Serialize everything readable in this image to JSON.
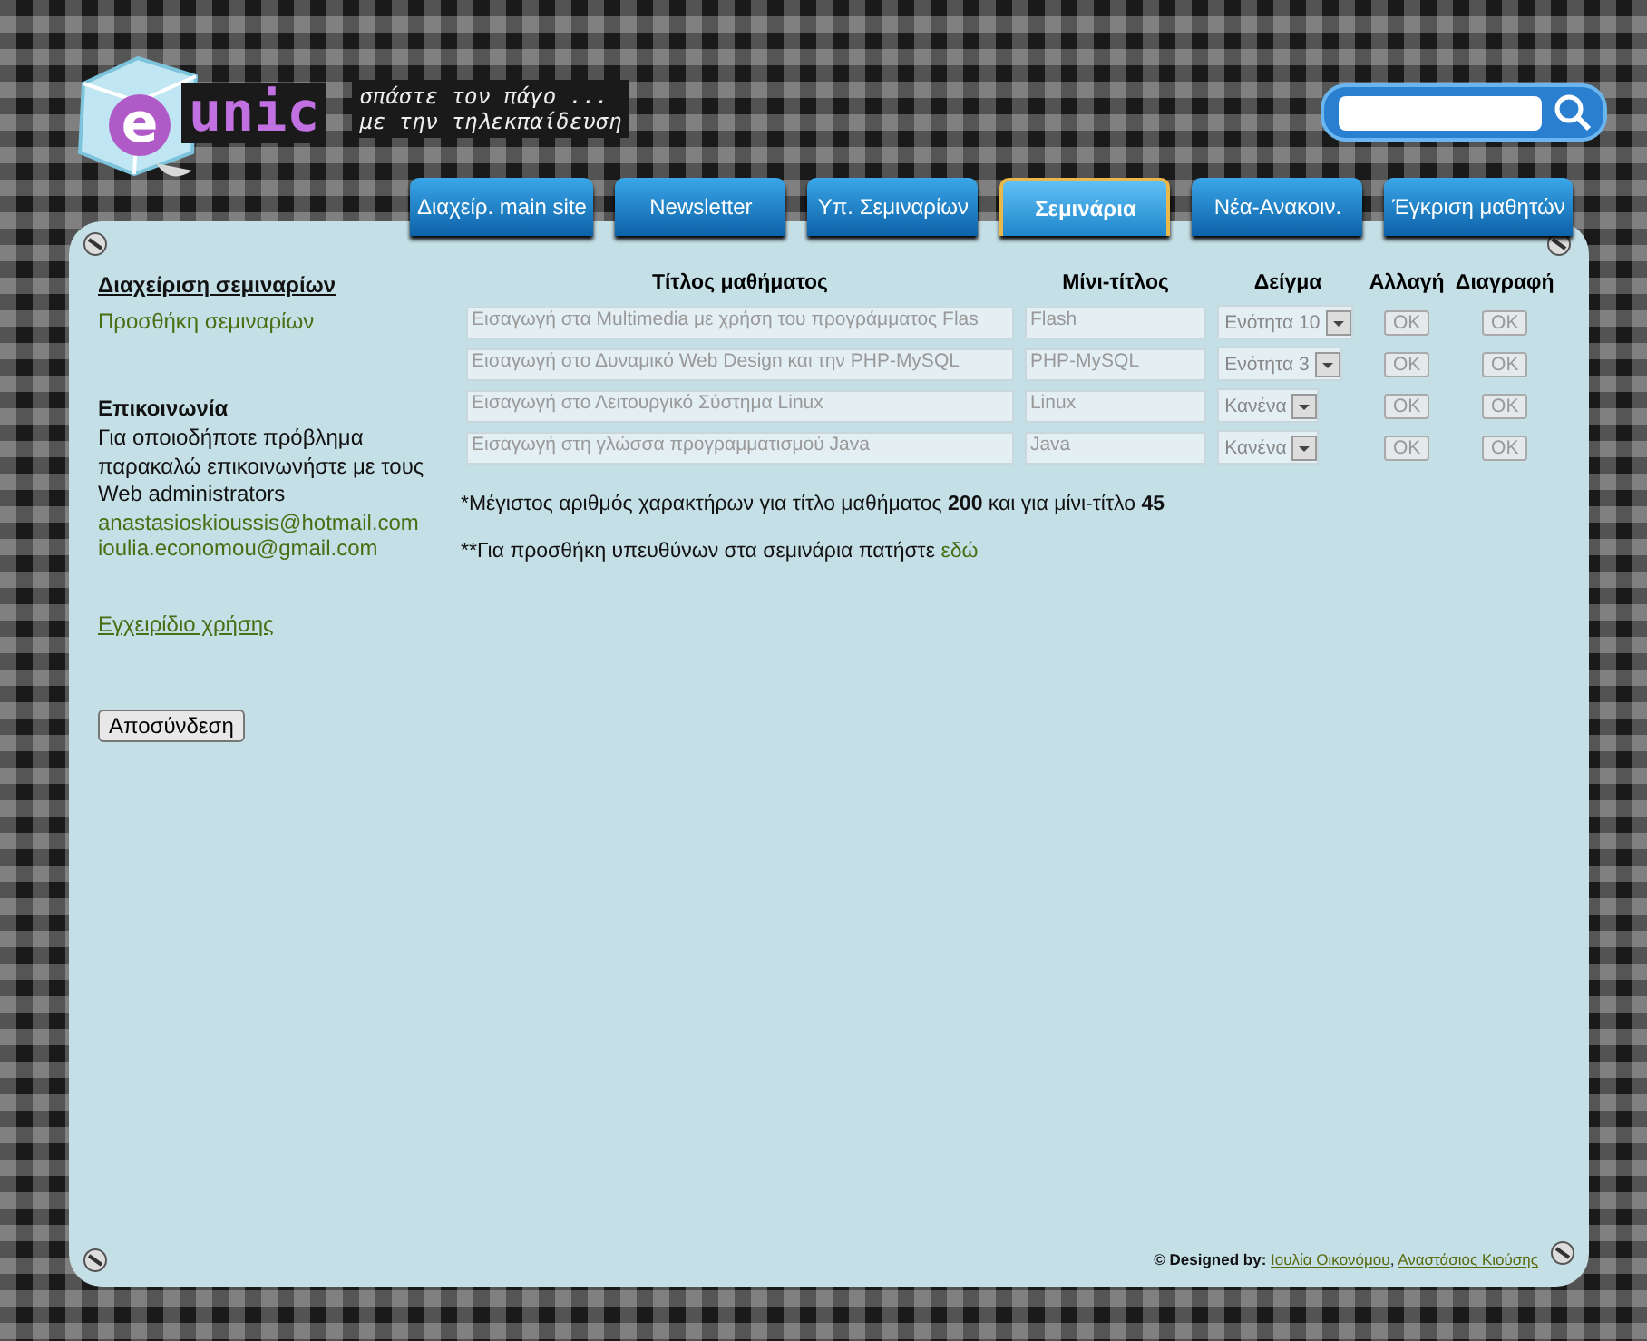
{
  "logo": {
    "letter": "e",
    "text": "unic"
  },
  "tagline": [
    "σπάστε τον πάγο ...",
    "με την τηλεκπαίδευση"
  ],
  "tabs": [
    {
      "label": "Διαχείρ. main site",
      "selected": false
    },
    {
      "label": "Newsletter",
      "selected": false
    },
    {
      "label": "Υπ. Σεμιναρίων",
      "selected": false
    },
    {
      "label": "Σεμινάρια",
      "selected": true
    },
    {
      "label": "Νέα-Ανακοιν.",
      "selected": false
    },
    {
      "label": "Έγκριση μαθητών",
      "selected": false
    }
  ],
  "sidebar": {
    "heading": "Διαχείριση σεμιναρίων",
    "add_link": "Προσθήκη σεμιναρίων",
    "contact_heading": "Επικοινωνία",
    "contact_text": "Για οποιοδήποτε πρόβλημα παρακαλώ επικοινωνήστε με τους Web administrators",
    "emails": [
      "anastasioskioussis@hotmail.com",
      "ioulia.economou@gmail.com"
    ],
    "manual_link": "Εγχειρίδιο χρήσης",
    "logout_button": "Αποσύνδεση"
  },
  "table": {
    "columns": [
      "Τίτλος μαθήματος",
      "Μίνι-τίτλος",
      "Δείγμα",
      "Αλλαγή",
      "Διαγραφή"
    ],
    "rows": [
      {
        "title": "Εισαγωγή στα Multimedia με χρήση του προγράμματος Flas",
        "mini_title": "Flash",
        "sample": "Ενότητα 10",
        "change": "OK",
        "delete": "OK"
      },
      {
        "title": "Εισαγωγή στο Δυναμικό Web Design και την PHP-MySQL",
        "mini_title": "PHP-MySQL",
        "sample": "Ενότητα 3",
        "change": "OK",
        "delete": "OK"
      },
      {
        "title": "Εισαγωγή στο Λειτουργικό Σύστημα Linux",
        "mini_title": "Linux",
        "sample": "Κανένα",
        "change": "OK",
        "delete": "OK"
      },
      {
        "title": "Εισαγωγή στη γλώσσα προγραμματισμού Java",
        "mini_title": "Java",
        "sample": "Κανένα",
        "change": "OK",
        "delete": "OK"
      }
    ]
  },
  "note_limits": "*Μέγιστος αριθμός χαρακτήρων για τίτλο μαθήματος **200** και για μίνι-τίτλο **45**",
  "note_responsible": {
    "text": "**Για προσθήκη υπευθύνων στα σεμινάρια πατήστε",
    "link": "εδώ"
  },
  "footer": {
    "prefix": "© Designed by:",
    "authors": [
      "Ιουλία Οικονόμου",
      "Αναστάσιος Κιούσης"
    ],
    "separator": ","
  }
}
